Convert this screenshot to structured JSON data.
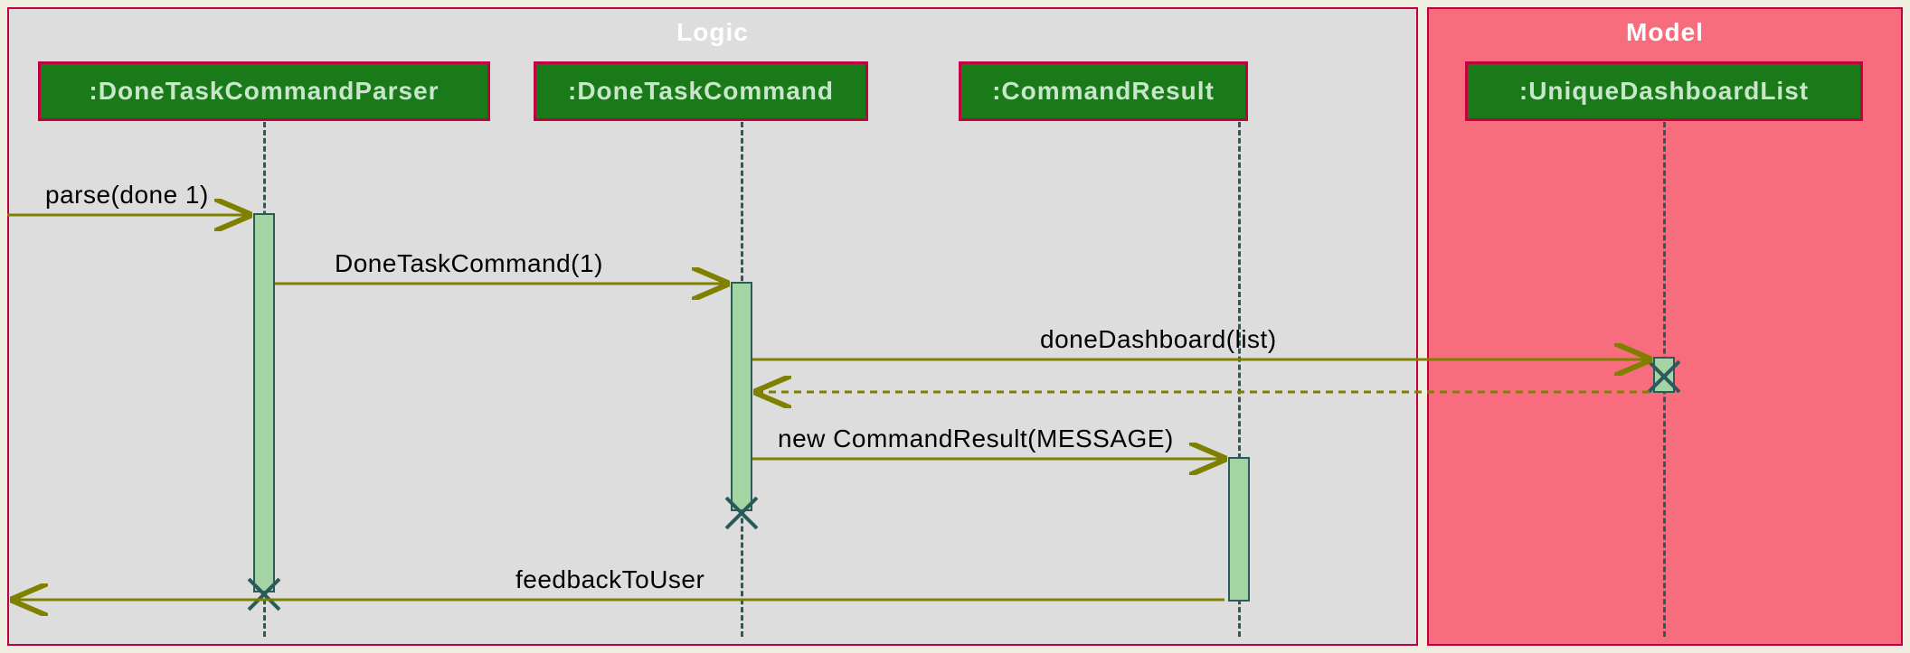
{
  "frames": {
    "logic": "Logic",
    "model": "Model"
  },
  "participants": {
    "parser": ":DoneTaskCommandParser",
    "command": ":DoneTaskCommand",
    "result": ":CommandResult",
    "dashboard": ":UniqueDashboardList"
  },
  "messages": {
    "parse": "parse(done 1)",
    "doneTaskCommand": "DoneTaskCommand(1)",
    "doneDashboard": "doneDashboard(list)",
    "newCommandResult": "new CommandResult(MESSAGE)",
    "feedback": "feedbackToUser"
  },
  "colors": {
    "frameBorder": "#c00040",
    "logicBg": "#dddddd",
    "modelBg": "#f76d7e",
    "participantBg": "#1a7a1a",
    "participantText": "#c8e6c9",
    "lifeline": "#2a5a5a",
    "activation": "#a4d4a4",
    "arrow": "#808000"
  }
}
